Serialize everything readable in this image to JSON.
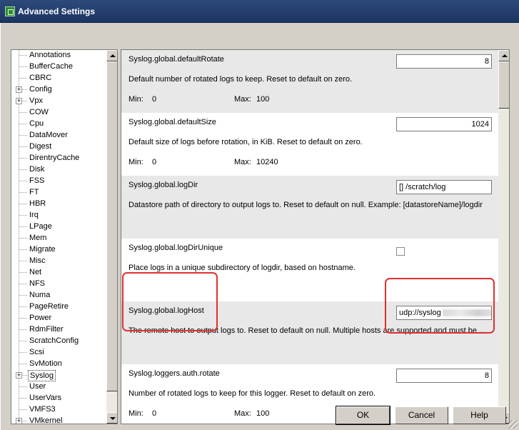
{
  "window": {
    "title": "Advanced Settings"
  },
  "tree": {
    "items": [
      {
        "label": "Annotations",
        "expandable": false
      },
      {
        "label": "BufferCache",
        "expandable": false
      },
      {
        "label": "CBRC",
        "expandable": false
      },
      {
        "label": "Config",
        "expandable": true
      },
      {
        "label": "Vpx",
        "expandable": true
      },
      {
        "label": "COW",
        "expandable": false
      },
      {
        "label": "Cpu",
        "expandable": false
      },
      {
        "label": "DataMover",
        "expandable": false
      },
      {
        "label": "Digest",
        "expandable": false
      },
      {
        "label": "DirentryCache",
        "expandable": false
      },
      {
        "label": "Disk",
        "expandable": false
      },
      {
        "label": "FSS",
        "expandable": false
      },
      {
        "label": "FT",
        "expandable": false
      },
      {
        "label": "HBR",
        "expandable": false
      },
      {
        "label": "Irq",
        "expandable": false
      },
      {
        "label": "LPage",
        "expandable": false
      },
      {
        "label": "Mem",
        "expandable": false
      },
      {
        "label": "Migrate",
        "expandable": false
      },
      {
        "label": "Misc",
        "expandable": false
      },
      {
        "label": "Net",
        "expandable": false
      },
      {
        "label": "NFS",
        "expandable": false
      },
      {
        "label": "Numa",
        "expandable": false
      },
      {
        "label": "PageRetire",
        "expandable": false
      },
      {
        "label": "Power",
        "expandable": false
      },
      {
        "label": "RdmFilter",
        "expandable": false
      },
      {
        "label": "ScratchConfig",
        "expandable": false
      },
      {
        "label": "Scsi",
        "expandable": false
      },
      {
        "label": "SvMotion",
        "expandable": false
      },
      {
        "label": "Syslog",
        "expandable": true,
        "selected": true
      },
      {
        "label": "User",
        "expandable": false
      },
      {
        "label": "UserVars",
        "expandable": false
      },
      {
        "label": "VMFS3",
        "expandable": false
      },
      {
        "label": "VMkernel",
        "expandable": true
      }
    ]
  },
  "settings": [
    {
      "name": "Syslog.global.defaultRotate",
      "value": "8",
      "type": "number",
      "description": "Default number of rotated logs to keep. Reset to default on zero.",
      "min_label": "Min:",
      "min": "0",
      "max_label": "Max:",
      "max": "100"
    },
    {
      "name": "Syslog.global.defaultSize",
      "value": "1024",
      "type": "number",
      "description": "Default size of logs before rotation, in KiB. Reset to default on zero.",
      "min_label": "Min:",
      "min": "0",
      "max_label": "Max:",
      "max": "10240"
    },
    {
      "name": "Syslog.global.logDir",
      "value": "[] /scratch/log",
      "type": "text",
      "description": "Datastore path of directory to output logs to. Reset to default on null. Example: [datastoreName]/logdir"
    },
    {
      "name": "Syslog.global.logDirUnique",
      "type": "checkbox",
      "checked": false,
      "description": "Place logs in a unique subdirectory of logdir, based on hostname."
    },
    {
      "name": "Syslog.global.logHost",
      "value": "udp://syslog",
      "value_suffix": ":",
      "type": "text",
      "blurred": true,
      "description": "The remote host to output logs to. Reset to default on null. Multiple hosts are supported and must be separated with comma (,)."
    },
    {
      "name": "Syslog.loggers.auth.rotate",
      "value": "8",
      "type": "number",
      "description": "Number of rotated logs to keep for this logger. Reset to default on zero.",
      "min_label": "Min:",
      "min": "0",
      "max_label": "Max:",
      "max": "100"
    }
  ],
  "buttons": {
    "ok": "OK",
    "cancel": "Cancel",
    "help": "Help"
  },
  "colors": {
    "highlight": "#e03030",
    "title_bar": "#1c3563",
    "row_alt": "#e8e8e8"
  }
}
